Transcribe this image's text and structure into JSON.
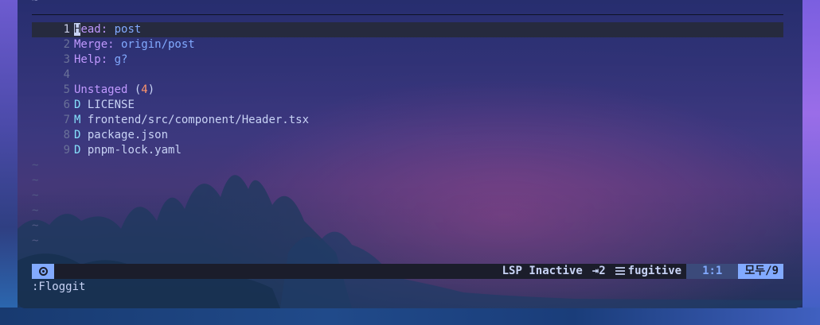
{
  "editor": {
    "lines": [
      {
        "num": "1",
        "key": "Head:",
        "value": " post"
      },
      {
        "num": "2",
        "key": "Merge:",
        "value": " origin/post"
      },
      {
        "num": "3",
        "key": "Help:",
        "value": " g?"
      },
      {
        "num": "4"
      },
      {
        "num": "5",
        "section": "Unstaged",
        "paren_open": " (",
        "count": "4",
        "paren_close": ")"
      },
      {
        "num": "6",
        "status": "D",
        "file": "LICENSE"
      },
      {
        "num": "7",
        "status": "M",
        "file": "frontend/src/component/Header.tsx"
      },
      {
        "num": "8",
        "status": "D",
        "file": "package.json"
      },
      {
        "num": "9",
        "status": "D",
        "file": "pnpm-lock.yaml"
      }
    ],
    "tilde": "~",
    "cursor_char": "H",
    "line1_rest": "ead:"
  },
  "statusline": {
    "lsp": "LSP Inactive",
    "indent": "⇥2",
    "filetype": "fugitive",
    "position": "1:1",
    "percent": "모두/9"
  },
  "cmdline": ":Floggit",
  "colors": {
    "accent": "#82aaff",
    "purple": "#c099ff",
    "orange": "#ff966c",
    "cyan": "#86e1fc"
  }
}
